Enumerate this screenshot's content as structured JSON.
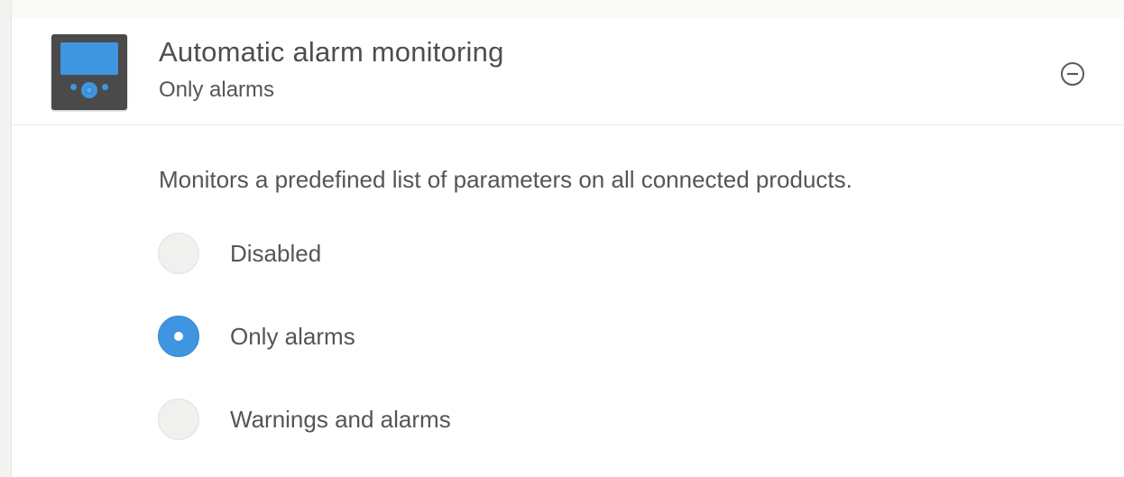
{
  "setting": {
    "title": "Automatic alarm monitoring",
    "current_value": "Only alarms",
    "icon": "device-panel-icon",
    "collapse_icon": "minus-circle-icon",
    "description": "Monitors a predefined list of parameters on all connected products.",
    "options": [
      {
        "label": "Disabled",
        "selected": false
      },
      {
        "label": "Only alarms",
        "selected": true
      },
      {
        "label": "Warnings and alarms",
        "selected": false
      }
    ]
  },
  "colors": {
    "accent": "#3f95e0",
    "text": "#555555",
    "device_body": "#4a4a4a"
  }
}
